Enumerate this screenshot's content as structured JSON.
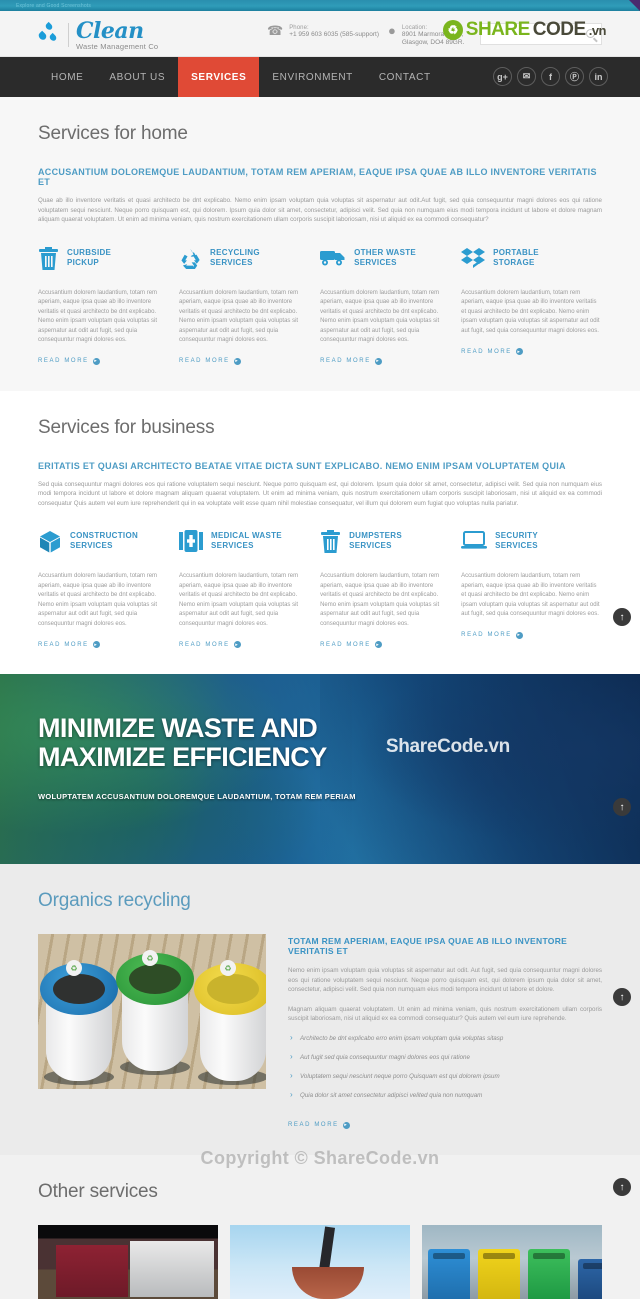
{
  "topbar": {
    "text": "Explore and Good Screenshots"
  },
  "header": {
    "logo_name": "Clean",
    "logo_tagline": "Waste Management Co",
    "phone_label": "Phone:",
    "phone_value": "+1 959 603 6035 (585-support)",
    "location_label": "Location:",
    "location_value_1": "8901 Marmora Road,",
    "location_value_2": "Glasgow, DO4 89GR.",
    "search_placeholder": "",
    "search_value": "",
    "watermark": {
      "mark": "♻",
      "part1": "SHARE",
      "part2": "CODE",
      "part3": ".vn"
    }
  },
  "nav": {
    "items": [
      {
        "label": "HOME",
        "active": false
      },
      {
        "label": "ABOUT US",
        "active": false
      },
      {
        "label": "SERVICES",
        "active": true
      },
      {
        "label": "ENVIRONMENT",
        "active": false
      },
      {
        "label": "CONTACT",
        "active": false
      }
    ],
    "social": [
      {
        "name": "googleplus",
        "glyph": "g+"
      },
      {
        "name": "twitter",
        "glyph": "✉"
      },
      {
        "name": "facebook",
        "glyph": "f"
      },
      {
        "name": "pinterest",
        "glyph": "Ⓟ"
      },
      {
        "name": "linkedin",
        "glyph": "in"
      }
    ],
    "accent_color": "#e04a36"
  },
  "home_section": {
    "title": "Services for home",
    "lead_head": "ACCUSANTIUM DOLOREMQUE LAUDANTIUM, TOTAM REM APERIAM, EAQUE IPSA QUAE AB ILLO INVENTORE VERITATIS ET",
    "lead_body": "Quae ab illo inventore veritatis et quasi architecto be dnt explicabo. Nemo enim ipsam voluptam quia voluptas sit aspernatur aut odit.Aut fugit, sed quia consequuntur magni dolores eos qui ratione voluptatem sequi nesciunt. Neque porro quisquam est, qui dolorem. Ipsum quia dolor sit amet, consectetur, adipisci velit. Sed quia non numquam eius modi tempora incidunt ut labore et dolore magnam aliquam quaerat voluptatem. Ut enim ad minima veniam, quis nostrum exercitationem ullam corporis suscipit laboriosam, nisi ut aliquid ex ea commodi consequatur?",
    "cards": [
      {
        "icon": "trash-can-icon",
        "title": "CURBSIDE\nPICKUP",
        "title_1": "CURBSIDE",
        "title_2": "PICKUP",
        "body": "Accusantium dolorem laudantium, totam rem aperiam, eaque ipsa quae ab illo inventore veritatis et quasi architecto be dnt explicabo. Nemo enim ipsam voluptam quia voluptas sit aspernatur aut odit aut fugit, sed quia consequuntur magni dolores eos.",
        "read_more": "READ MORE"
      },
      {
        "icon": "recycle-icon",
        "title_1": "RECYCLING",
        "title_2": "SERVICES",
        "body": "Accusantium dolorem laudantium, totam rem aperiam, eaque ipsa quae ab illo inventore veritatis et quasi architecto be dnt explicabo. Nemo enim ipsam voluptam quia voluptas sit aspernatur aut odit aut fugit, sed quia consequuntur magni dolores eos.",
        "read_more": "READ MORE"
      },
      {
        "icon": "truck-icon",
        "title_1": "OTHER WASTE",
        "title_2": "SERVICES",
        "body": "Accusantium dolorem laudantium, totam rem aperiam, eaque ipsa quae ab illo inventore veritatis et quasi architecto be dnt explicabo. Nemo enim ipsam voluptam quia voluptas sit aspernatur aut odit aut fugit, sed quia consequuntur magni dolores eos.",
        "read_more": "READ MORE"
      },
      {
        "icon": "boxes-icon",
        "title_1": "PORTABLE",
        "title_2": "STORAGE",
        "body": "Accusantium dolorem laudantium, totam rem aperiam, eaque ipsa quae ab illo inventore veritatis et quasi architecto be dnt explicabo. Nemo enim ipsam voluptam quia voluptas sit aspernatur aut odit aut fugit, sed quia consequuntur magni dolores eos.",
        "read_more": "READ MORE"
      }
    ]
  },
  "business_section": {
    "title": "Services for business",
    "lead_head": "ERITATIS ET QUASI ARCHITECTO BEATAE VITAE DICTA SUNT EXPLICABO. NEMO ENIM IPSAM VOLUPTATEM QUIA",
    "lead_body": "Sed quia consequuntur magni dolores eos qui ratione voluptatem sequi nesciunt. Neque porro quisquam est, qui dolorem. Ipsum quia dolor sit amet, consectetur, adipisci velit. Sed quia non numquam eius modi tempora incidunt ut labore et dolore magnam aliquam quaerat voluptatem. Ut enim ad minima veniam, quis nostrum exercitationem ullam corporis suscipit laboriosam, nisi ut aliquid ex ea commodi consequatur Quis autem vel eum iure reprehenderit qui in ea voluptate velit esse quam nihil molestiae consequatur, vel illum qui dolorem eum fugiat quo voluptas nulla pariatur.",
    "cards": [
      {
        "icon": "cube-icon",
        "title_1": "CONSTRUCTION",
        "title_2": "SERVICES",
        "body": "Accusantium dolorem laudantium, totam rem aperiam, eaque ipsa quae ab illo inventore veritatis et quasi architecto be dnt explicabo. Nemo enim ipsam voluptam quia voluptas sit aspernatur aut odit aut fugit, sed quia consequuntur magni dolores eos.",
        "read_more": "READ MORE"
      },
      {
        "icon": "first-aid-kit-icon",
        "title_1": "MEDICAL WASTE",
        "title_2": "SERVICES",
        "body": "Accusantium dolorem laudantium, totam rem aperiam, eaque ipsa quae ab illo inventore veritatis et quasi architecto be dnt explicabo. Nemo enim ipsam voluptam quia voluptas sit aspernatur aut odit aut fugit, sed quia consequuntur magni dolores eos.",
        "read_more": "READ MORE"
      },
      {
        "icon": "trash-can-icon",
        "title_1": "DUMPSTERS",
        "title_2": "SERVICES",
        "body": "Accusantium dolorem laudantium, totam rem aperiam, eaque ipsa quae ab illo inventore veritatis et quasi architecto be dnt explicabo. Nemo enim ipsam voluptam quia voluptas sit aspernatur aut odit aut fugit, sed quia consequuntur magni dolores eos.",
        "read_more": "READ MORE"
      },
      {
        "icon": "laptop-icon",
        "title_1": "SECURITY",
        "title_2": "SERVICES",
        "body": "Accusantium dolorem laudantium, totam rem aperiam, eaque ipsa quae ab illo inventore veritatis et quasi architecto be dnt explicabo. Nemo enim ipsam voluptam quia voluptas sit aspernatur aut odit aut fugit, sed quia consequuntur magni dolores eos.",
        "read_more": "READ MORE"
      }
    ]
  },
  "banner": {
    "title_line1": "MINIMIZE WASTE AND",
    "title_line2": "MAXIMIZE EFFICIENCY",
    "subtitle": "WOLUPTATEM ACCUSANTIUM DOLOREMQUE LAUDANTIUM, TOTAM REM PERIAM",
    "watermark": "ShareCode.vn"
  },
  "organics_section": {
    "title": "Organics recycling",
    "head": "TOTAM REM APERIAM, EAQUE IPSA QUAE AB ILLO INVENTORE VERITATIS ET",
    "para1": "Nemo enim ipsam voluptam quia voluptas sit aspernatur aut odit. Aut fugit, sed quia consequuntur magni dolores eos qui ratione voluptatem sequi nesciunt. Neque porro quisquam est, qui dolorem ipsum quia dolor sit amet, consectetur, adipisci velit. Sed quia non numquam eius modi tempora incidunt ut labore et dolore.",
    "para2": "Magnam aliquam quaerat voluptatem. Ut enim ad minima veniam, quis nostrum exercitationem ullam corporis suscipit laboriosam, nisi ut aliquid ex ea commodi consequatur? Quis autem vel eum iure reprehende.",
    "bullets": [
      "Architecto be dnt explicabo erro enim ipsam voluptam quia voluptas sitasp",
      "Aut fugit sed quia consequuntur magni dolores eos qui ratione",
      "Voluptatem sequi nesciunt neque porro Quisquam est qui dolorem ipsum",
      "Quia dolor sit amet consectetur adipisci velited quia non numquam"
    ],
    "read_more": "READ MORE"
  },
  "other_section": {
    "title": "Other services",
    "photos": [
      {
        "name": "garbage-truck-photo"
      },
      {
        "name": "crane-claw-photo"
      },
      {
        "name": "colored-bins-photo"
      }
    ]
  },
  "watermarks": {
    "copyright": "Copyright © ShareCode.vn"
  },
  "scroll_top": {
    "glyph": "↑",
    "count": 4
  }
}
